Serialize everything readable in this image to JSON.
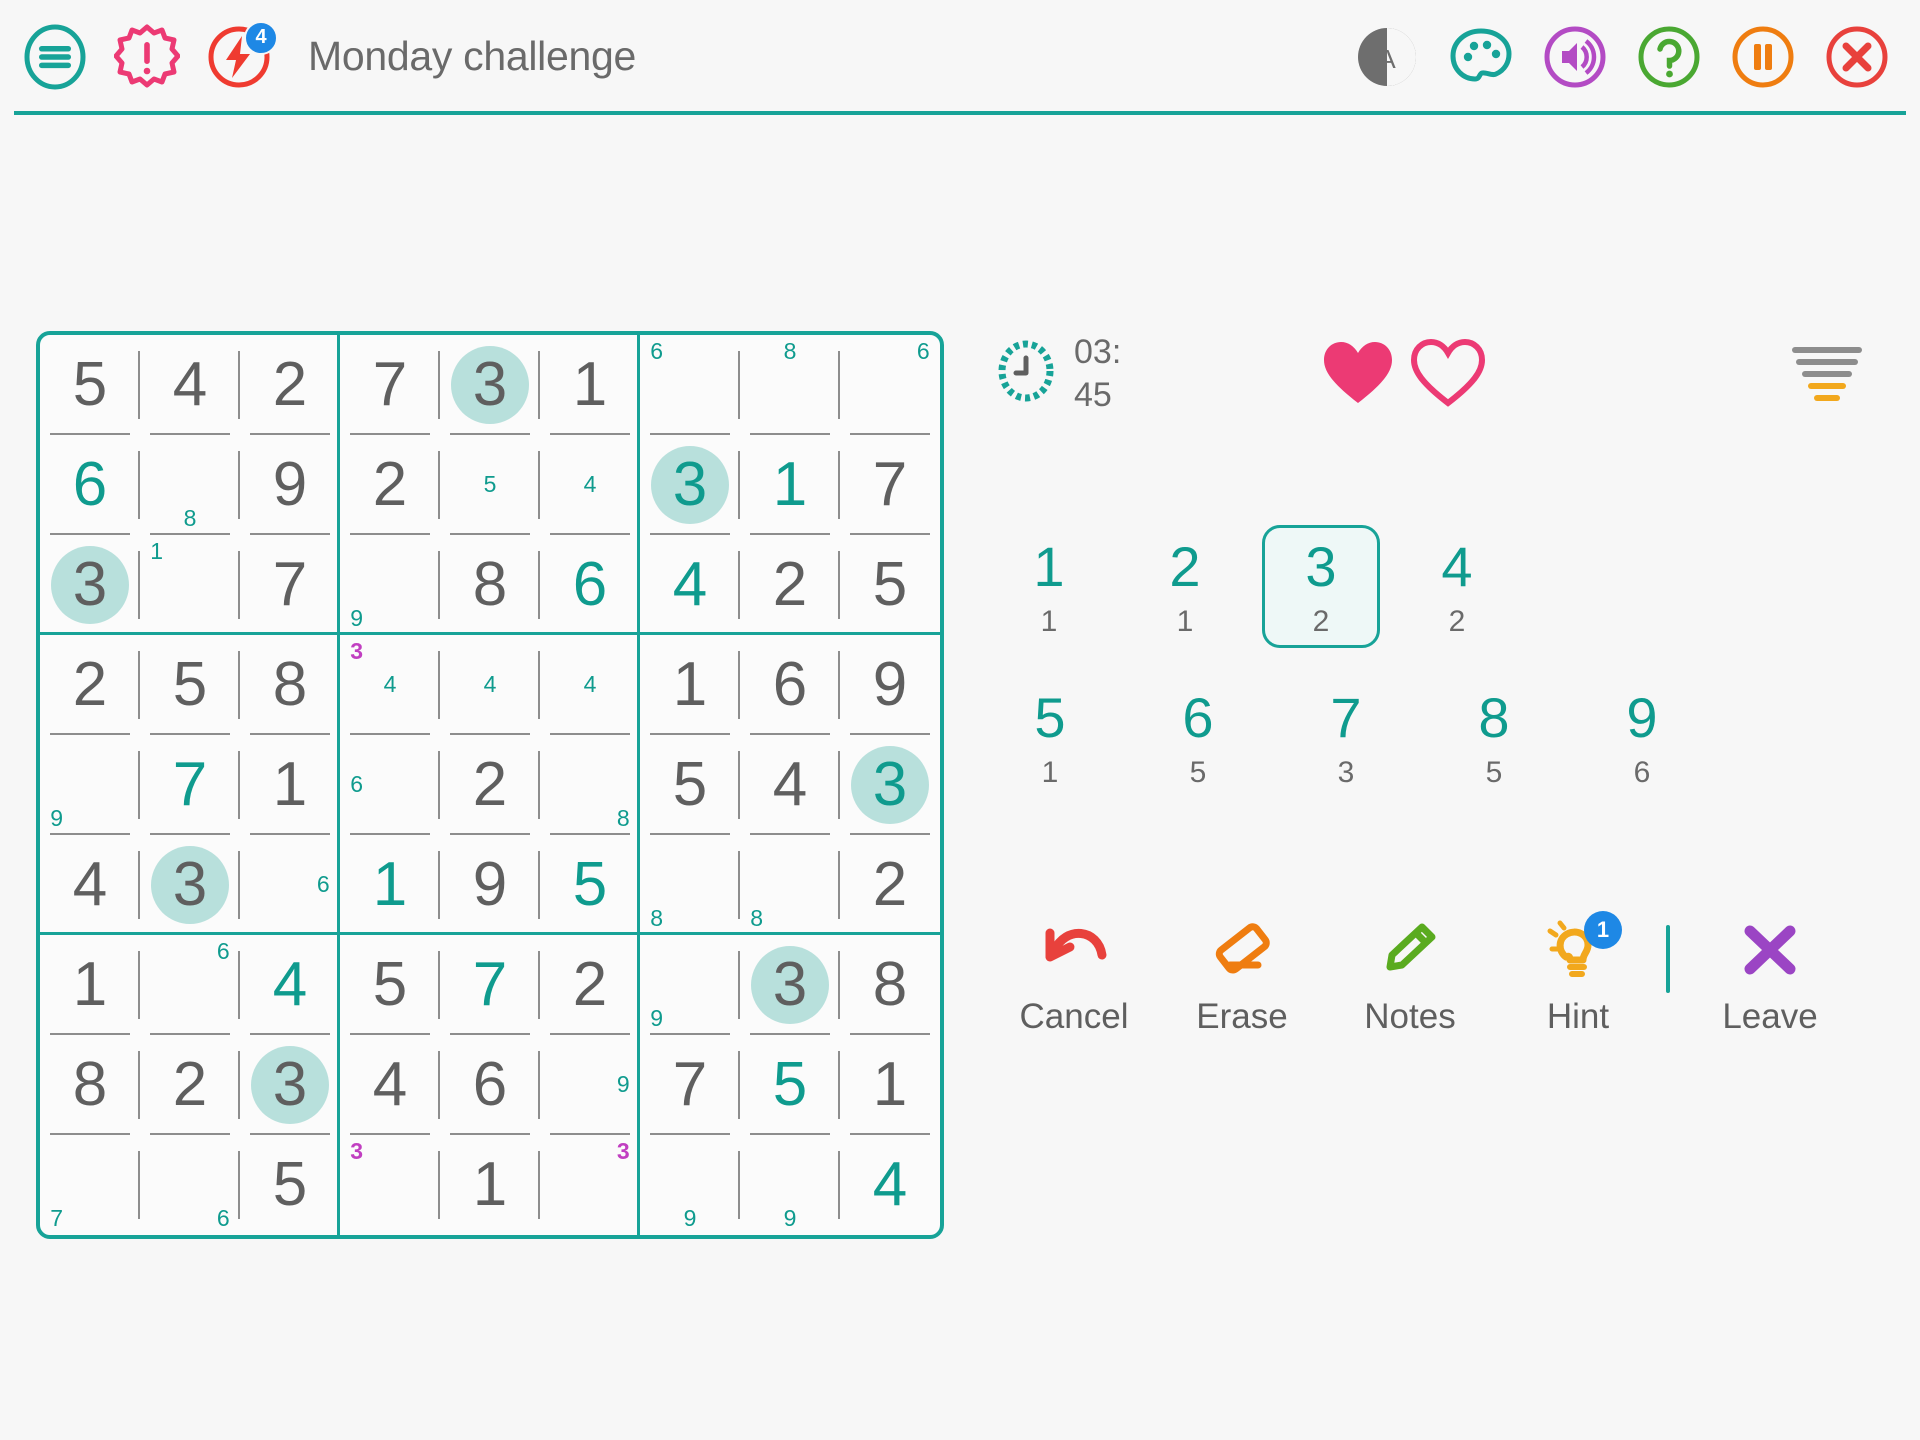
{
  "header": {
    "menu_label": "menu",
    "mistakes_label": "mistakes",
    "energy_label": "energy",
    "energy_badge": "4",
    "title": "Monday challenge",
    "theme_label": "A",
    "palette_label": "theme",
    "sound_label": "sound",
    "help_label": "help",
    "pause_label": "pause",
    "close_label": "close"
  },
  "status": {
    "time": "03:\n45",
    "hearts_total": 2,
    "hearts_filled": 1,
    "difficulty_label": "difficulty"
  },
  "numpad": {
    "keys": [
      {
        "num": "1",
        "count": "1",
        "selected": false
      },
      {
        "num": "2",
        "count": "1",
        "selected": false
      },
      {
        "num": "3",
        "count": "2",
        "selected": true
      },
      {
        "num": "4",
        "count": "2",
        "selected": false
      },
      {
        "num": "5",
        "count": "1",
        "selected": false
      },
      {
        "num": "6",
        "count": "5",
        "selected": false
      },
      {
        "num": "7",
        "count": "3",
        "selected": false
      },
      {
        "num": "8",
        "count": "5",
        "selected": false
      },
      {
        "num": "9",
        "count": "6",
        "selected": false
      }
    ]
  },
  "actions": [
    {
      "name": "cancel",
      "label": "Cancel",
      "icon": "undo-arrow-icon",
      "color": "#e8413c",
      "badge": null
    },
    {
      "name": "erase",
      "label": "Erase",
      "icon": "eraser-icon",
      "color": "#ef7d10",
      "badge": null
    },
    {
      "name": "notes",
      "label": "Notes",
      "icon": "pencil-icon",
      "color": "#5aab1f",
      "badge": null
    },
    {
      "name": "hint",
      "label": "Hint",
      "icon": "lightbulb-icon",
      "color": "#f2a81d",
      "badge": "1"
    },
    {
      "name": "leave",
      "label": "Leave",
      "icon": "cross-icon",
      "color": "#9b45c4",
      "badge": null
    }
  ],
  "colors": {
    "teal": "#17a398",
    "teal_value": "#0f9b8e",
    "given": "#5f5f5f",
    "highlight": "#b8e0dc",
    "note_teal": "#0f9b8e",
    "note_magenta": "#c13fc1",
    "pink": "#ec3a74",
    "background": "#f7f7f7"
  },
  "board": {
    "cells": [
      [
        {
          "v": "5",
          "t": "given"
        },
        {
          "v": "4",
          "t": "given"
        },
        {
          "v": "2",
          "t": "given"
        },
        {
          "v": "7",
          "t": "given"
        },
        {
          "v": "3",
          "t": "given",
          "hl": true
        },
        {
          "v": "1",
          "t": "given"
        },
        {
          "n": {
            "1": "6"
          }
        },
        {
          "n": {
            "2": "8"
          }
        },
        {
          "n": {
            "3": "6"
          }
        }
      ],
      [
        {
          "v": "6",
          "t": "user"
        },
        {
          "n": {
            "8": "8"
          }
        },
        {
          "v": "9",
          "t": "given"
        },
        {
          "v": "2",
          "t": "given"
        },
        {
          "n": {
            "5": "5"
          }
        },
        {
          "n": {
            "5": "4"
          }
        },
        {
          "v": "3",
          "t": "user",
          "hl": true
        },
        {
          "v": "1",
          "t": "user"
        },
        {
          "v": "7",
          "t": "given"
        }
      ],
      [
        {
          "v": "3",
          "t": "given",
          "hl": true
        },
        {
          "n": {
            "1": "1"
          }
        },
        {
          "v": "7",
          "t": "given"
        },
        {
          "n": {
            "7": "9"
          }
        },
        {
          "v": "8",
          "t": "given"
        },
        {
          "v": "6",
          "t": "user"
        },
        {
          "v": "4",
          "t": "user"
        },
        {
          "v": "2",
          "t": "given"
        },
        {
          "v": "5",
          "t": "given"
        }
      ],
      [
        {
          "v": "2",
          "t": "given"
        },
        {
          "v": "5",
          "t": "given"
        },
        {
          "v": "8",
          "t": "given"
        },
        {
          "n": {
            "1": "3m",
            "5": "4"
          }
        },
        {
          "n": {
            "5": "4"
          }
        },
        {
          "n": {
            "5": "4"
          }
        },
        {
          "v": "1",
          "t": "given"
        },
        {
          "v": "6",
          "t": "given"
        },
        {
          "v": "9",
          "t": "given"
        }
      ],
      [
        {
          "n": {
            "7": "9"
          }
        },
        {
          "v": "7",
          "t": "user"
        },
        {
          "v": "1",
          "t": "given"
        },
        {
          "n": {
            "4": "6"
          }
        },
        {
          "v": "2",
          "t": "given"
        },
        {
          "n": {
            "9": "8"
          }
        },
        {
          "v": "5",
          "t": "given"
        },
        {
          "v": "4",
          "t": "given"
        },
        {
          "v": "3",
          "t": "user",
          "hl": true
        }
      ],
      [
        {
          "v": "4",
          "t": "given"
        },
        {
          "v": "3",
          "t": "given",
          "hl": true
        },
        {
          "n": {
            "6": "6"
          }
        },
        {
          "v": "1",
          "t": "user"
        },
        {
          "v": "9",
          "t": "given"
        },
        {
          "v": "5",
          "t": "user"
        },
        {
          "n": {
            "7": "8"
          }
        },
        {
          "n": {
            "7": "8"
          }
        },
        {
          "v": "2",
          "t": "given"
        }
      ],
      [
        {
          "v": "1",
          "t": "given"
        },
        {
          "n": {
            "3": "6"
          }
        },
        {
          "v": "4",
          "t": "user"
        },
        {
          "v": "5",
          "t": "given"
        },
        {
          "v": "7",
          "t": "user"
        },
        {
          "v": "2",
          "t": "given"
        },
        {
          "n": {
            "7": "9"
          }
        },
        {
          "v": "3",
          "t": "given",
          "hl": true
        },
        {
          "v": "8",
          "t": "given"
        }
      ],
      [
        {
          "v": "8",
          "t": "given"
        },
        {
          "v": "2",
          "t": "given"
        },
        {
          "v": "3",
          "t": "given",
          "hl": true
        },
        {
          "v": "4",
          "t": "given"
        },
        {
          "v": "6",
          "t": "given"
        },
        {
          "n": {
            "6": "9"
          }
        },
        {
          "v": "7",
          "t": "given"
        },
        {
          "v": "5",
          "t": "user"
        },
        {
          "v": "1",
          "t": "given"
        }
      ],
      [
        {
          "n": {
            "7": "7"
          }
        },
        {
          "n": {
            "9": "6"
          }
        },
        {
          "v": "5",
          "t": "given"
        },
        {
          "n": {
            "1": "3m"
          }
        },
        {
          "v": "1",
          "t": "given"
        },
        {
          "n": {
            "3": "3m"
          }
        },
        {
          "n": {
            "8": "9"
          }
        },
        {
          "n": {
            "8": "9"
          }
        },
        {
          "v": "4",
          "t": "user"
        }
      ]
    ]
  }
}
